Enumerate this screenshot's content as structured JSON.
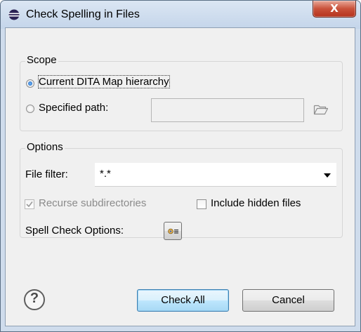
{
  "window": {
    "title": "Check Spelling in Files",
    "close_glyph": "X"
  },
  "scope": {
    "label": "Scope",
    "option_current": "Current DITA Map hierarchy",
    "option_specified": "Specified path:",
    "path_value": "",
    "selected": "current"
  },
  "options": {
    "label": "Options",
    "file_filter_label": "File filter:",
    "file_filter_value": "*.*",
    "recurse_label": "Recurse subdirectories",
    "recurse_checked": true,
    "recurse_enabled": false,
    "hidden_label": "Include hidden files",
    "hidden_checked": false,
    "spell_options_label": "Spell Check Options:"
  },
  "buttons": {
    "help_glyph": "?",
    "check_all": "Check All",
    "cancel": "Cancel"
  },
  "icons": {
    "title": "eclipse-icon",
    "browse": "folder-open-icon",
    "combo": "dropdown-arrow-icon",
    "spell_options": "settings-icon",
    "help": "help-icon"
  },
  "colors": {
    "accent": "#3c7fb1",
    "close": "#c9513a",
    "background": "#f0f0f0"
  }
}
